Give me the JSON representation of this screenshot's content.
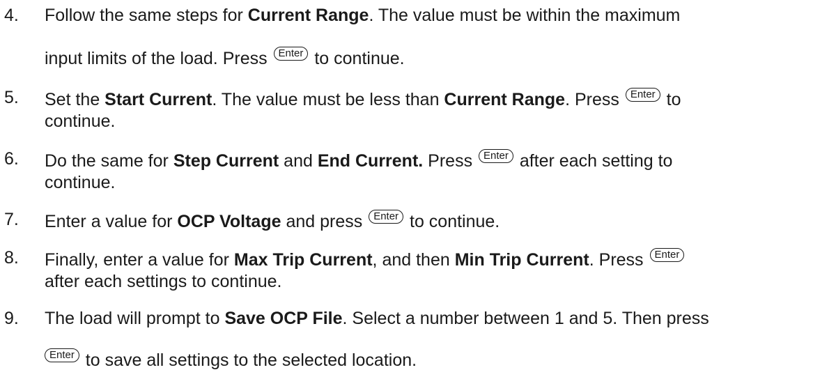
{
  "key_label": "Enter",
  "steps": [
    {
      "number": "4.",
      "l1_a": "Follow the same steps for ",
      "l1_b": "Current Range",
      "l1_c": ".  The value must be within the maximum",
      "l2_a": "input limits of the load.  Press ",
      "l2_b": " to continue."
    },
    {
      "number": "5.",
      "l1_a": "Set the ",
      "l1_b": "Start Current",
      "l1_c": ".  The value must be less than ",
      "l1_d": "Current Range",
      "l1_e": ".  Press ",
      "l1_f": " to",
      "l2_a": "continue."
    },
    {
      "number": "6.",
      "l1_a": "Do the same for ",
      "l1_b": "Step Current",
      "l1_c": " and ",
      "l1_d": "End Current.",
      "l1_e": "  Press ",
      "l1_f": " after each setting to",
      "l2_a": "continue."
    },
    {
      "number": "7.",
      "l1_a": "Enter a value for ",
      "l1_b": "OCP Voltage",
      "l1_c": " and press ",
      "l1_d": " to continue."
    },
    {
      "number": "8.",
      "l1_a": "Finally, enter a value for ",
      "l1_b": "Max Trip Current",
      "l1_c": ", and then ",
      "l1_d": "Min Trip Current",
      "l1_e": ".  Press ",
      "l2_a": "after each settings to continue."
    },
    {
      "number": "9.",
      "l1_a": "The load will prompt to ",
      "l1_b": "Save OCP File",
      "l1_c": ".  Select a number between 1 and 5.  Then press",
      "l2_a": " to save all settings to the selected location."
    }
  ]
}
